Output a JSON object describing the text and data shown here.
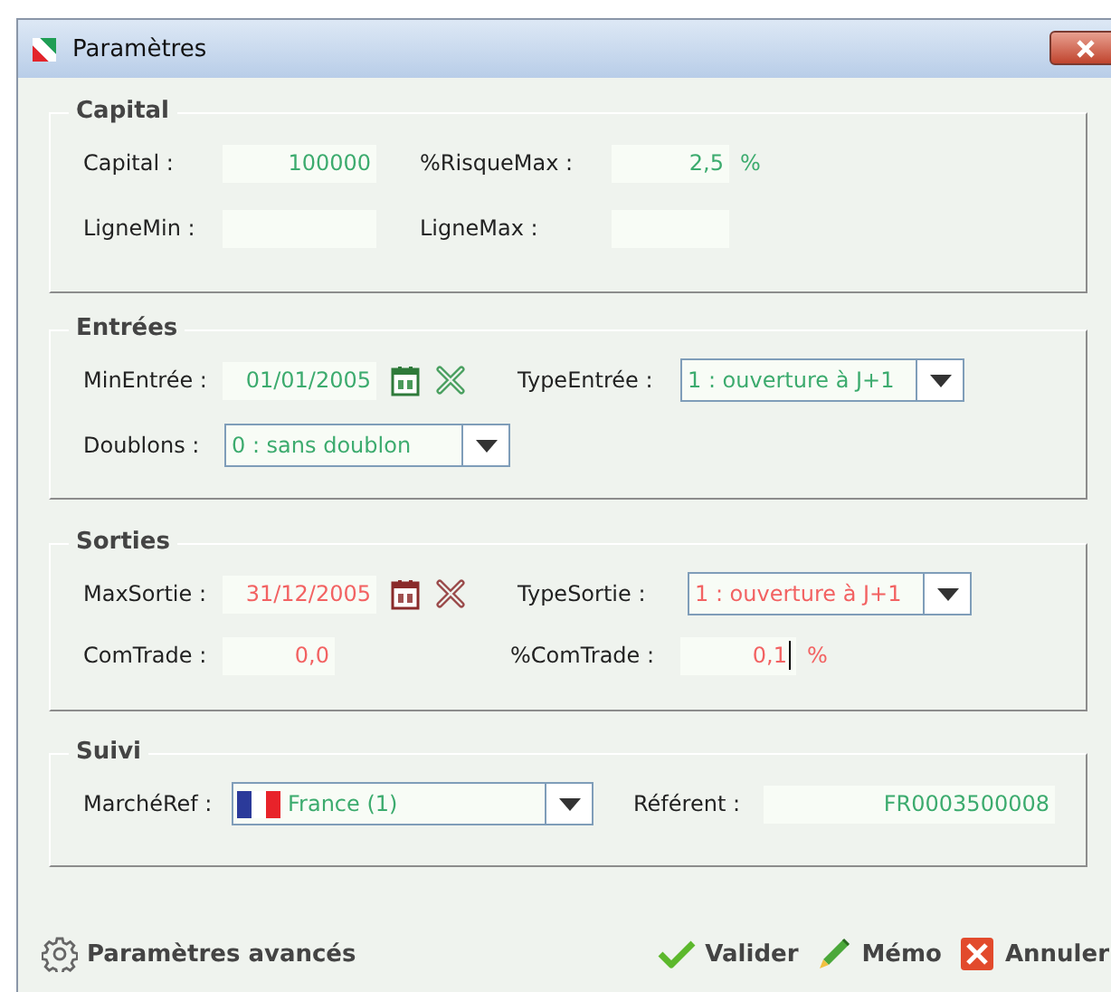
{
  "window": {
    "title": "Paramètres"
  },
  "sections": [
    {
      "title": "Capital",
      "color": "#3cab6e",
      "rows": [
        [
          {
            "kind": "number",
            "label": "Capital :",
            "value": "100000"
          },
          {
            "kind": "number",
            "label": "%RisqueMax :",
            "value": "2,5",
            "unit": "%"
          }
        ],
        [
          {
            "kind": "number",
            "label": "LigneMin :"
          },
          {
            "kind": "number",
            "label": "LigneMax :"
          }
        ]
      ]
    },
    {
      "title": "Entrées",
      "color": "#3cab6e",
      "rows": [
        [
          {
            "kind": "date",
            "label": "MinEntrée :",
            "value": "01/01/2005"
          },
          {
            "kind": "select",
            "label": "TypeEntrée :",
            "value": "1 : ouverture à J+1"
          }
        ],
        [
          {
            "kind": "select",
            "label": "Doublons :",
            "value": "0 : sans doublon"
          }
        ]
      ]
    },
    {
      "title": "Sorties",
      "color": "#f26262",
      "rows": [
        [
          {
            "kind": "date",
            "label": "MaxSortie :",
            "value": "31/12/2005"
          },
          {
            "kind": "select",
            "label": "TypeSortie :",
            "value": "1 : ouverture à J+1"
          }
        ],
        [
          {
            "kind": "number",
            "label": "ComTrade :",
            "value": "0,0"
          },
          {
            "kind": "number",
            "label": "%ComTrade :",
            "value": "0,1",
            "unit": "%",
            "focused": true
          }
        ]
      ]
    },
    {
      "title": "Suivi",
      "color": "#3cab6e",
      "rows": [
        [
          {
            "kind": "flag-select",
            "label": "MarchéRef :",
            "value": "France (1)"
          },
          {
            "kind": "number",
            "label": "Référent :",
            "value": "FR0003500008"
          }
        ]
      ]
    }
  ],
  "footer": {
    "advanced": "Paramètres avancés",
    "buttons": [
      {
        "kind": "validate",
        "label": "Valider"
      },
      {
        "kind": "memo",
        "label": "Mémo"
      },
      {
        "kind": "cancel",
        "label": "Annuler"
      }
    ]
  }
}
